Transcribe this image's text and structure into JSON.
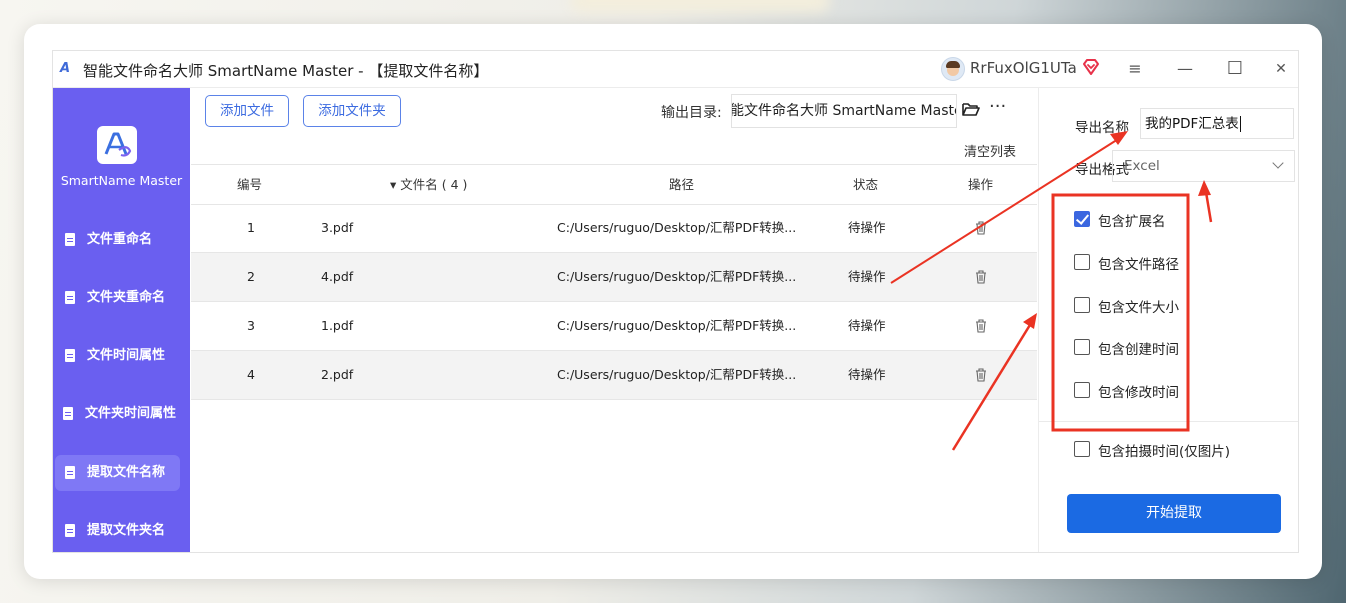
{
  "window": {
    "title": "智能文件命名大师 SmartName Master - 【提取文件名称】",
    "username": "RrFuxOlG1UTa",
    "controls": {
      "menu": "≡",
      "minimize": "—",
      "maximize": "☐",
      "close": "✕"
    }
  },
  "sidebar": {
    "logo_text": "SmartName Master",
    "items": [
      {
        "label": "文件重命名"
      },
      {
        "label": "文件夹重命名"
      },
      {
        "label": "文件时间属性"
      },
      {
        "label": "文件夹时间属性"
      },
      {
        "label": "提取文件名称",
        "active": true
      },
      {
        "label": "提取文件夹名"
      }
    ]
  },
  "toolbar": {
    "add_file": "添加文件",
    "add_folder": "添加文件夹",
    "output_label": "输出目录:",
    "output_path": "能文件命名大师 SmartName Master",
    "more": "···",
    "clear_list": "清空列表"
  },
  "table": {
    "headers": {
      "index": "编号",
      "filename": "▾ 文件名 ( 4 )",
      "path": "路径",
      "status": "状态",
      "action": "操作"
    },
    "rows": [
      {
        "index": "1",
        "filename": "3.pdf",
        "path": "C:/Users/ruguo/Desktop/汇帮PDF转换...",
        "status": "待操作"
      },
      {
        "index": "2",
        "filename": "4.pdf",
        "path": "C:/Users/ruguo/Desktop/汇帮PDF转换...",
        "status": "待操作"
      },
      {
        "index": "3",
        "filename": "1.pdf",
        "path": "C:/Users/ruguo/Desktop/汇帮PDF转换...",
        "status": "待操作"
      },
      {
        "index": "4",
        "filename": "2.pdf",
        "path": "C:/Users/ruguo/Desktop/汇帮PDF转换...",
        "status": "待操作"
      }
    ]
  },
  "panel": {
    "export_name_label": "导出名称",
    "export_name_value": "我的PDF汇总表",
    "export_format_label": "导出格式",
    "export_format_value": "Excel",
    "options": [
      {
        "label": "包含扩展名",
        "checked": true
      },
      {
        "label": "包含文件路径",
        "checked": false
      },
      {
        "label": "包含文件大小",
        "checked": false
      },
      {
        "label": "包含创建时间",
        "checked": false
      },
      {
        "label": "包含修改时间",
        "checked": false
      },
      {
        "label": "包含拍摄时间(仅图片)",
        "checked": false
      }
    ],
    "start_button": "开始提取"
  },
  "colors": {
    "sidebar": "#6a5ff0",
    "accent": "#1b6ae3",
    "annotation": "#ea3323"
  }
}
